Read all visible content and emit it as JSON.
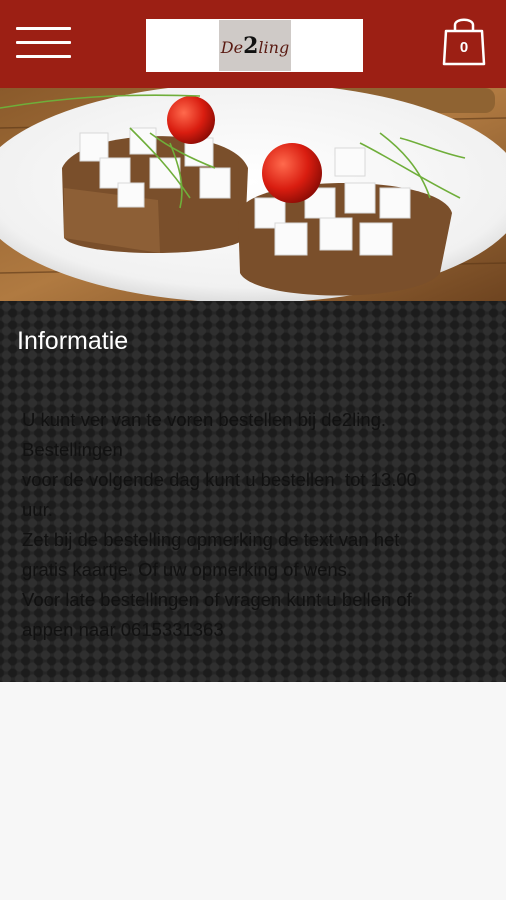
{
  "header": {
    "menu_icon": "hamburger-menu-icon",
    "logo": {
      "text_prefix": "De",
      "text_digit": "2",
      "text_suffix": "ling"
    },
    "cart": {
      "icon": "shopping-bag-icon",
      "count": "0"
    },
    "colors": {
      "background": "#9c1f14",
      "foreground": "#ffffff"
    }
  },
  "hero": {
    "image": "sandwiches-with-feta-and-tomato"
  },
  "info": {
    "title": "Informatie",
    "lines": [
      "U kunt ver van te voren bestellen bij de2ling.",
      "Bestellingen",
      "voor de volgende dag kunt u bestellen  tot 13.00",
      "uur.",
      "Zet bij de bestelling opmerking de text van het",
      "gratis kaartje. Of uw opmerking of wens.",
      "Voor late bestellingen of vragen kunt u bellen of",
      "appen naar 0615331363"
    ]
  }
}
